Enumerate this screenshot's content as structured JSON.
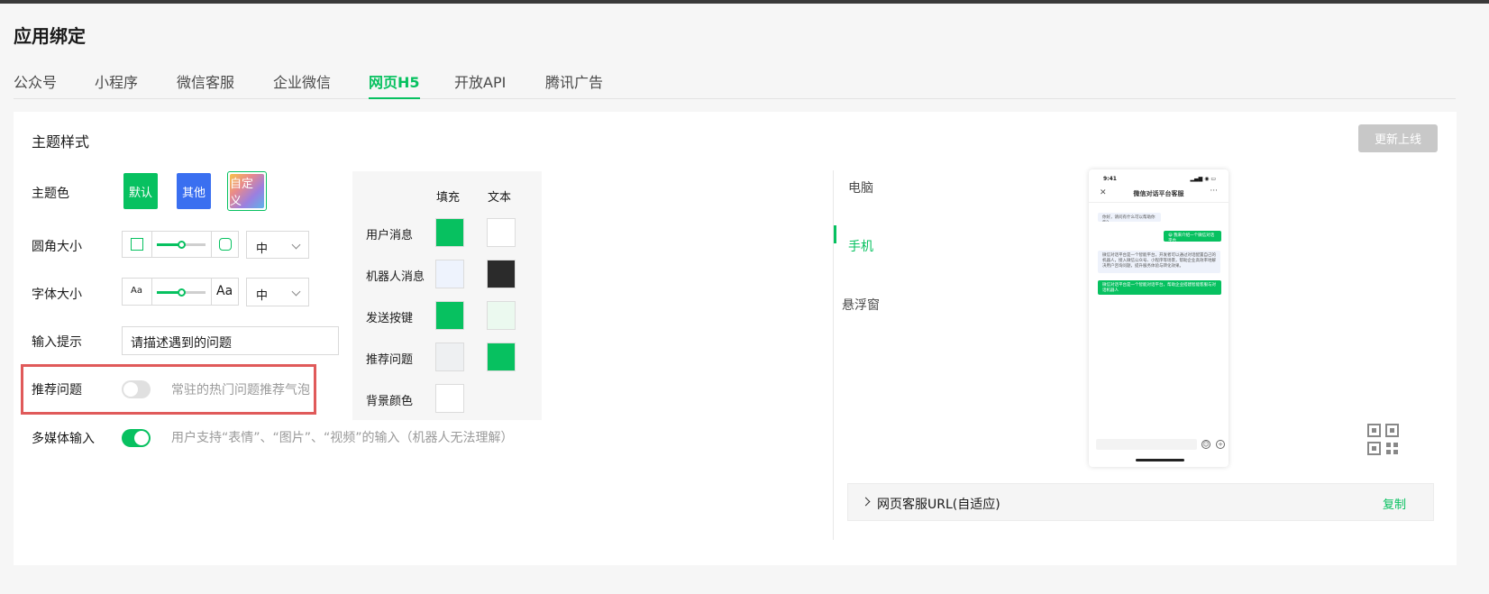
{
  "page": {
    "title": "应用绑定"
  },
  "tabs": [
    {
      "label": "公众号",
      "active": false
    },
    {
      "label": "小程序",
      "active": false
    },
    {
      "label": "微信客服",
      "active": false
    },
    {
      "label": "企业微信",
      "active": false
    },
    {
      "label": "网页H5",
      "active": true
    },
    {
      "label": "开放API",
      "active": false
    },
    {
      "label": "腾讯广告",
      "active": false
    }
  ],
  "theme": {
    "section_title": "主题样式",
    "publish_button": "更新上线",
    "color": {
      "label": "主题色",
      "options": [
        {
          "label": "默认",
          "color": "#07c160"
        },
        {
          "label": "其他",
          "color": "#3a6ff0"
        },
        {
          "label": "自定义",
          "color": "gradient"
        }
      ]
    },
    "radius": {
      "label": "圆角大小",
      "value": "中",
      "slider": 0.5
    },
    "font_size": {
      "label": "字体大小",
      "small_icon": "Aa",
      "large_icon": "Aa",
      "value": "中",
      "slider": 0.5
    },
    "input_hint": {
      "label": "输入提示",
      "value": "请描述遇到的问题"
    },
    "recommend": {
      "label": "推荐问题",
      "enabled": false,
      "hint": "常驻的热门问题推荐气泡"
    },
    "multimedia": {
      "label": "多媒体输入",
      "enabled": true,
      "hint": "用户支持“表情”、“图片”、“视频”的输入（机器人无法理解）"
    }
  },
  "color_panel": {
    "header_fill": "填充",
    "header_text": "文本",
    "rows": [
      {
        "label": "用户消息",
        "fill": "#07c160",
        "text": "#ffffff"
      },
      {
        "label": "机器人消息",
        "fill": "#eef3fd",
        "text": "#2b2b2b"
      },
      {
        "label": "发送按键",
        "fill": "#07c160",
        "text": "#ebf9ef"
      },
      {
        "label": "推荐问题",
        "fill": "#eef0f2",
        "text": "#07c160"
      },
      {
        "label": "背景颜色",
        "fill": "#ffffff",
        "text": null
      }
    ]
  },
  "preview": {
    "options": [
      {
        "label": "电脑",
        "active": false
      },
      {
        "label": "手机",
        "active": true
      },
      {
        "label": "悬浮窗",
        "active": false
      }
    ],
    "phone": {
      "time": "9:41",
      "title": "微信对话平台客服",
      "bubbles": [
        {
          "type": "bot",
          "text": "你好，请问有什么可以帮助你的？"
        },
        {
          "type": "user",
          "text": "😀 我来介绍一个微信对话平台"
        },
        {
          "type": "bot",
          "text": "微信对话平台是一个智能平台，开发者可以通过对话配置自己的机器人，接入微信公众号、小程序等场景，帮助企业高效率地解决用户咨询问题，提升服务体验与转化效果。"
        },
        {
          "type": "user",
          "text": "微信对话平台是一个智能对话平台，帮助企业搭建智能客服与对话机器人"
        }
      ]
    },
    "url_label": "网页客服URL(自适应)",
    "copy_label": "复制"
  }
}
